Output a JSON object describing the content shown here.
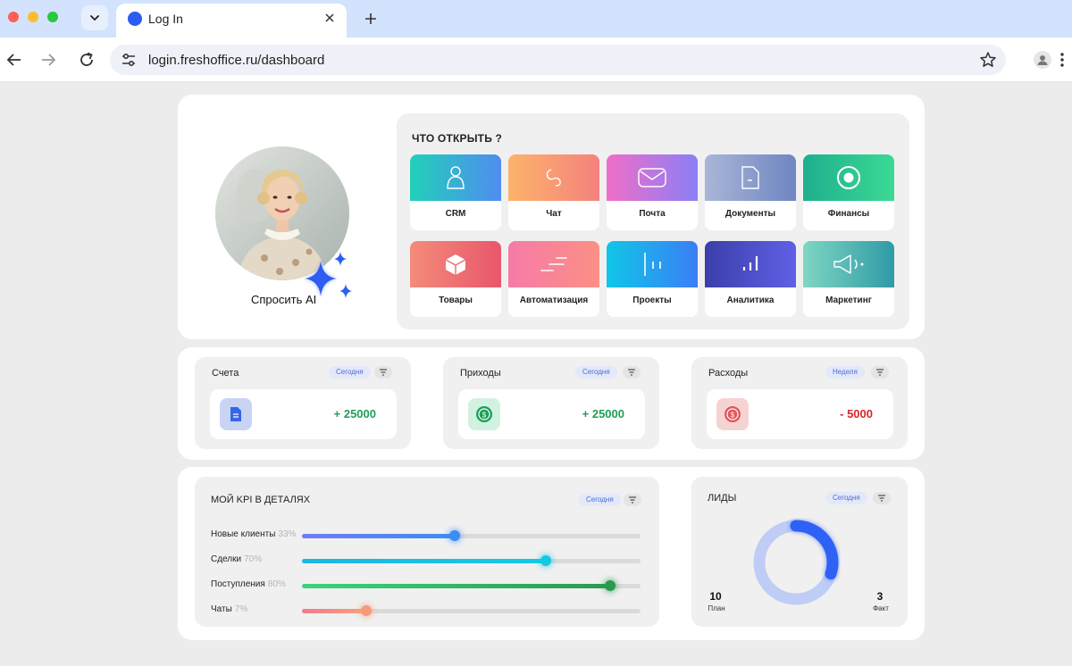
{
  "browser": {
    "tab_title": "Log In",
    "url": "login.freshoffice.ru/dashboard"
  },
  "profile": {
    "ask_ai_label": "Спросить AI"
  },
  "open_section": {
    "title": "ЧТО ОТКРЫТЬ ?",
    "tiles": [
      {
        "label": "CRM",
        "icon": "person-icon"
      },
      {
        "label": "Чат",
        "icon": "chat-icon"
      },
      {
        "label": "Почта",
        "icon": "mail-icon"
      },
      {
        "label": "Документы",
        "icon": "document-icon"
      },
      {
        "label": "Финансы",
        "icon": "target-icon"
      },
      {
        "label": "Товары",
        "icon": "box-icon"
      },
      {
        "label": "Автоматизация",
        "icon": "lines-icon"
      },
      {
        "label": "Проекты",
        "icon": "columns-icon"
      },
      {
        "label": "Аналитика",
        "icon": "bar-chart-icon"
      },
      {
        "label": "Маркетинг",
        "icon": "megaphone-icon"
      }
    ]
  },
  "summary": [
    {
      "title": "Счета",
      "period": "Сегодня",
      "value": "+ 25000",
      "icon": "invoice-icon",
      "value_color": "#1f9e58"
    },
    {
      "title": "Приходы",
      "period": "Сегодня",
      "value": "+ 25000",
      "icon": "coin-icon",
      "value_color": "#1f9e58"
    },
    {
      "title": "Расходы",
      "period": "Неделя",
      "value": "- 5000",
      "icon": "coin-icon",
      "value_color": "#d9262a"
    }
  ],
  "kpi": {
    "title": "МОЙ KPI В ДЕТАЛЯХ",
    "period": "Сегодня",
    "items": [
      {
        "label": "Новые клиенты",
        "percent_label": "33%",
        "fill": 0.45
      },
      {
        "label": "Сделки",
        "percent_label": "70%",
        "fill": 0.72
      },
      {
        "label": "Поступления",
        "percent_label": "80%",
        "fill": 0.91
      },
      {
        "label": "Чаты",
        "percent_label": "7%",
        "fill": 0.19
      }
    ]
  },
  "leads": {
    "title": "ЛИДЫ",
    "period": "Сегодня",
    "plan_value": "10",
    "plan_label": "План",
    "fact_value": "3",
    "fact_label": "Факт",
    "progress": 0.3
  },
  "colors": {
    "accent": "#2b5cf2",
    "positive": "#1f9e58",
    "negative": "#d9262a"
  }
}
